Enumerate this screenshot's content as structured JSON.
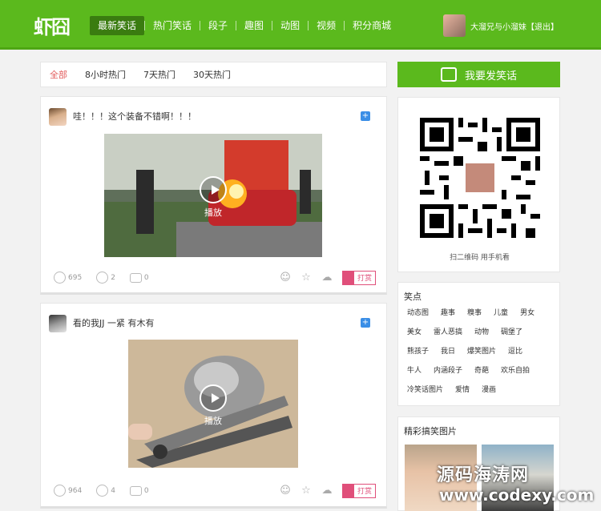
{
  "header": {
    "logo": "虾囧",
    "nav": [
      "最新笑话",
      "热门笑话",
      "段子",
      "趣图",
      "动图",
      "视频",
      "积分商城"
    ],
    "user_name": "大溜兄与小溜妹",
    "logout": "【退出】"
  },
  "filters": [
    "全部",
    "8小时热门",
    "7天热门",
    "30天热门"
  ],
  "posts": [
    {
      "title": "哇！！！这个装备不错啊！！！",
      "play_label": "播放",
      "likes": "695",
      "dislikes": "2",
      "comments": "0",
      "tip": "打赏"
    },
    {
      "title": "看的我JJ 一紧 有木有",
      "play_label": "播放",
      "likes": "964",
      "dislikes": "4",
      "comments": "0",
      "tip": "打赏"
    }
  ],
  "sidebar": {
    "cta": "我要发笑话",
    "qr_caption": "扫二维码 用手机看",
    "tags_title": "笑点",
    "tags": [
      "动态图",
      "趣事",
      "糗事",
      "儿童",
      "男女",
      "美女",
      "雷人恶搞",
      "动物",
      "碉堡了",
      "熊孩子",
      "我日",
      "爆笑图片",
      "逗比",
      "牛人",
      "内涵段子",
      "奇葩",
      "欢乐自拍",
      "冷笑话图片",
      "爱情",
      "漫画"
    ],
    "pics_title": "精彩搞笑图片"
  },
  "watermark": {
    "line1": "源码海涛网",
    "line2": "www.codexy.com"
  },
  "colors": {
    "brand_green": "#5bb91d",
    "active_filter": "#e25a5a",
    "tip": "#e04f7a"
  }
}
